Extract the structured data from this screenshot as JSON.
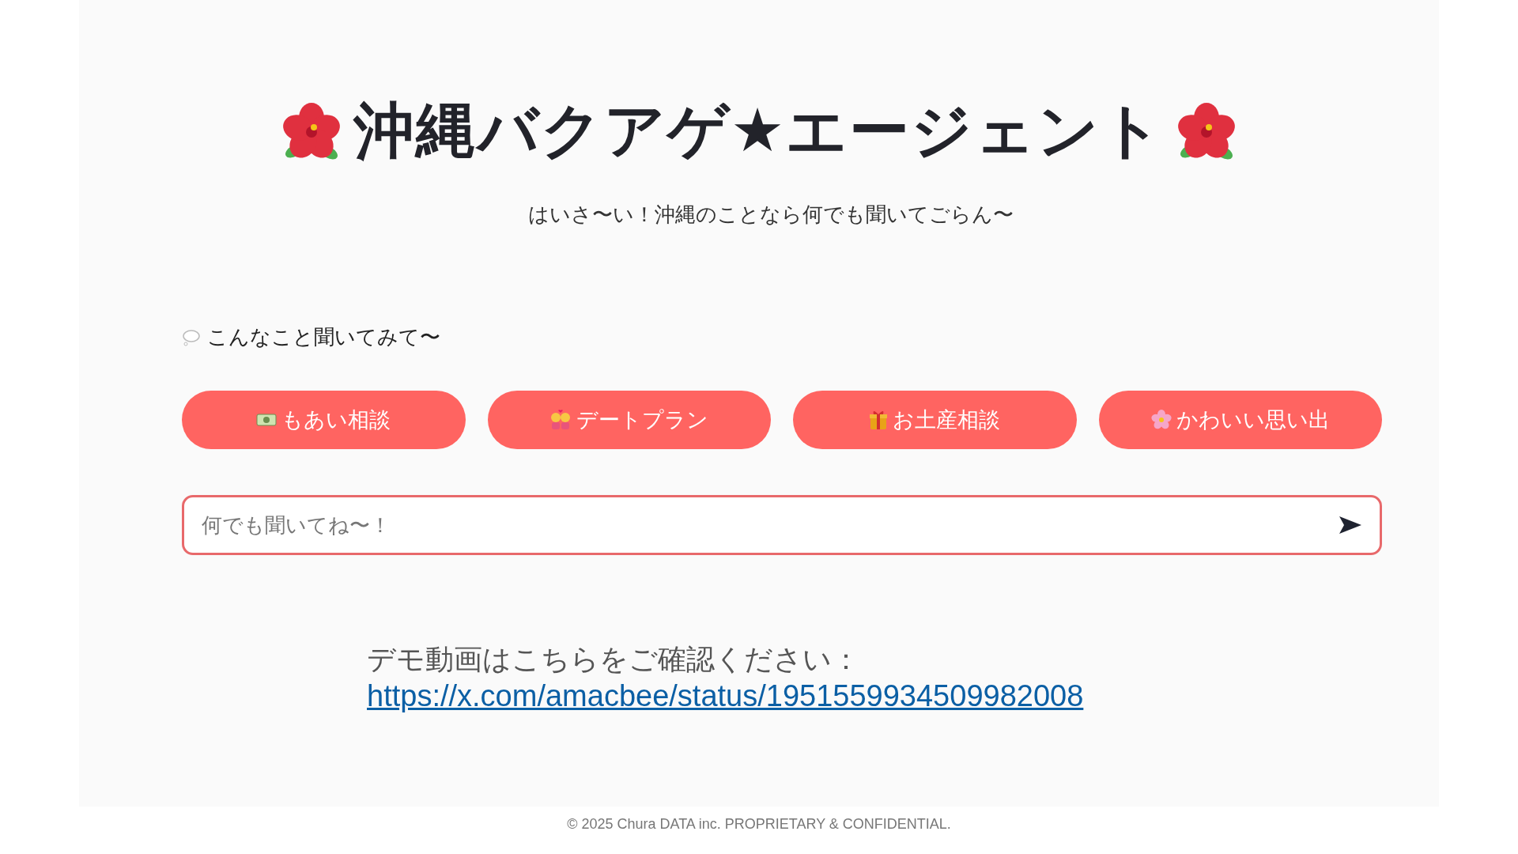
{
  "header": {
    "title": "沖縄バクアゲ★エージェント",
    "subtitle": "はいさ〜い！沖縄のことなら何でも聞いてごらん〜"
  },
  "suggestions": {
    "label": "こんなこと聞いてみて〜",
    "buttons": [
      {
        "label": "もあい相談"
      },
      {
        "label": "デートプラン"
      },
      {
        "label": "お土産相談"
      },
      {
        "label": "かわいい思い出"
      }
    ]
  },
  "chat_input": {
    "placeholder": "何でも聞いてね〜！"
  },
  "demo_note": {
    "text": "デモ動画はこちらをご確認ください：",
    "link": "https://x.com/amacbee/status/1951559934509982008"
  },
  "footer": "© 2025 Chura DATA inc. PROPRIETARY & CONFIDENTIAL."
}
